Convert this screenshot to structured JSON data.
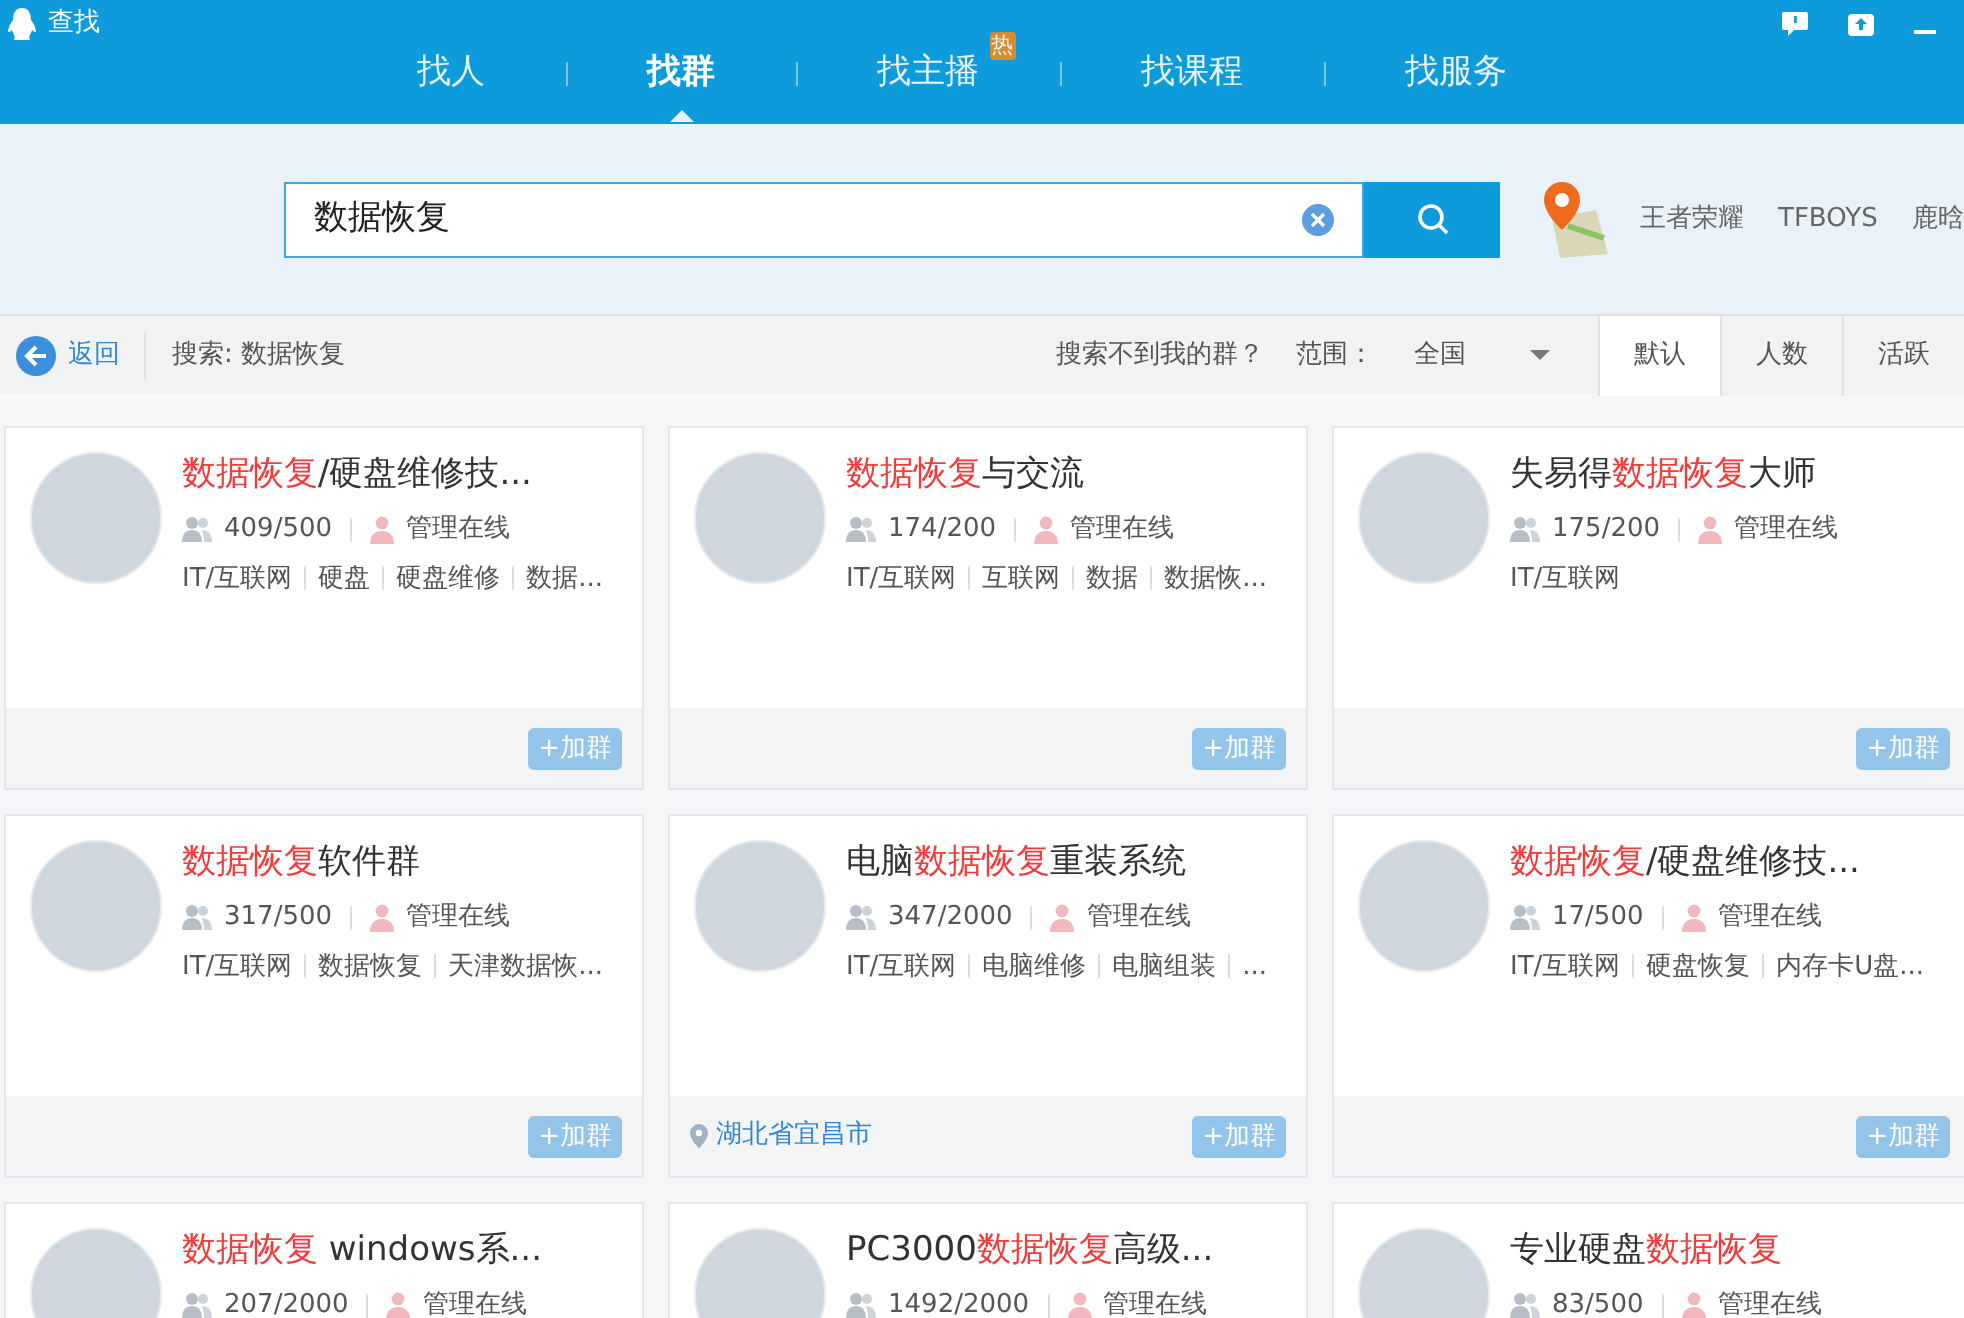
{
  "window": {
    "title": "查找"
  },
  "tabs": [
    {
      "label": "找人",
      "selected": false
    },
    {
      "label": "找群",
      "selected": true
    },
    {
      "label": "找主播",
      "selected": false,
      "badge": "热"
    },
    {
      "label": "找课程",
      "selected": false
    },
    {
      "label": "找服务",
      "selected": false
    }
  ],
  "search": {
    "value": "数据恢复"
  },
  "hot_words": [
    "王者荣耀",
    "TFBOYS",
    "鹿晗"
  ],
  "filter_bar": {
    "back": "返回",
    "query": "搜索: 数据恢复",
    "help": "搜索不到我的群？",
    "range_label": "范围：",
    "range_value": "全国",
    "sort_tabs": [
      {
        "label": "默认",
        "selected": true
      },
      {
        "label": "人数",
        "selected": false
      },
      {
        "label": "活跃",
        "selected": false
      }
    ]
  },
  "groups": [
    {
      "title": [
        {
          "text": "数据恢复",
          "highlight": true
        },
        {
          "text": "/硬盘维修技...",
          "highlight": false
        }
      ],
      "members": "409/500",
      "admin": "管理在线",
      "tags": [
        "IT/互联网",
        "硬盘",
        "硬盘维修",
        "数据..."
      ],
      "join": "+加群"
    },
    {
      "title": [
        {
          "text": "数据恢复",
          "highlight": true
        },
        {
          "text": "与交流",
          "highlight": false
        }
      ],
      "members": "174/200",
      "admin": "管理在线",
      "tags": [
        "IT/互联网",
        "互联网",
        "数据",
        "数据恢..."
      ],
      "join": "+加群"
    },
    {
      "title": [
        {
          "text": "失易得",
          "highlight": false
        },
        {
          "text": "数据恢复",
          "highlight": true
        },
        {
          "text": "大师",
          "highlight": false
        }
      ],
      "members": "175/200",
      "admin": "管理在线",
      "tags": [
        "IT/互联网"
      ],
      "join": "+加群"
    },
    {
      "title": [
        {
          "text": "数据恢复",
          "highlight": true
        },
        {
          "text": "软件群",
          "highlight": false
        }
      ],
      "members": "317/500",
      "admin": "管理在线",
      "tags": [
        "IT/互联网",
        "数据恢复",
        "天津数据恢..."
      ],
      "join": "+加群"
    },
    {
      "title": [
        {
          "text": "电脑",
          "highlight": false
        },
        {
          "text": "数据恢复",
          "highlight": true
        },
        {
          "text": "重装系统",
          "highlight": false
        }
      ],
      "members": "347/2000",
      "admin": "管理在线",
      "tags": [
        "IT/互联网",
        "电脑维修",
        "电脑组装",
        "..."
      ],
      "location": "湖北省宜昌市",
      "join": "+加群"
    },
    {
      "title": [
        {
          "text": "数据恢复",
          "highlight": true
        },
        {
          "text": "/硬盘维修技...",
          "highlight": false
        }
      ],
      "members": "17/500",
      "admin": "管理在线",
      "tags": [
        "IT/互联网",
        "硬盘恢复",
        "内存卡U盘..."
      ],
      "join": "+加群"
    },
    {
      "title": [
        {
          "text": "数据恢复",
          "highlight": true
        },
        {
          "text": " windows系...",
          "highlight": false
        }
      ],
      "members": "207/2000",
      "admin": "管理在线"
    },
    {
      "title": [
        {
          "text": "PC3000",
          "highlight": false
        },
        {
          "text": "数据恢复",
          "highlight": true
        },
        {
          "text": "高级...",
          "highlight": false
        }
      ],
      "members": "1492/2000",
      "admin": "管理在线"
    },
    {
      "title": [
        {
          "text": "专业硬盘",
          "highlight": false
        },
        {
          "text": "数据恢复",
          "highlight": true
        }
      ],
      "members": "83/500",
      "admin": "管理在线"
    }
  ]
}
